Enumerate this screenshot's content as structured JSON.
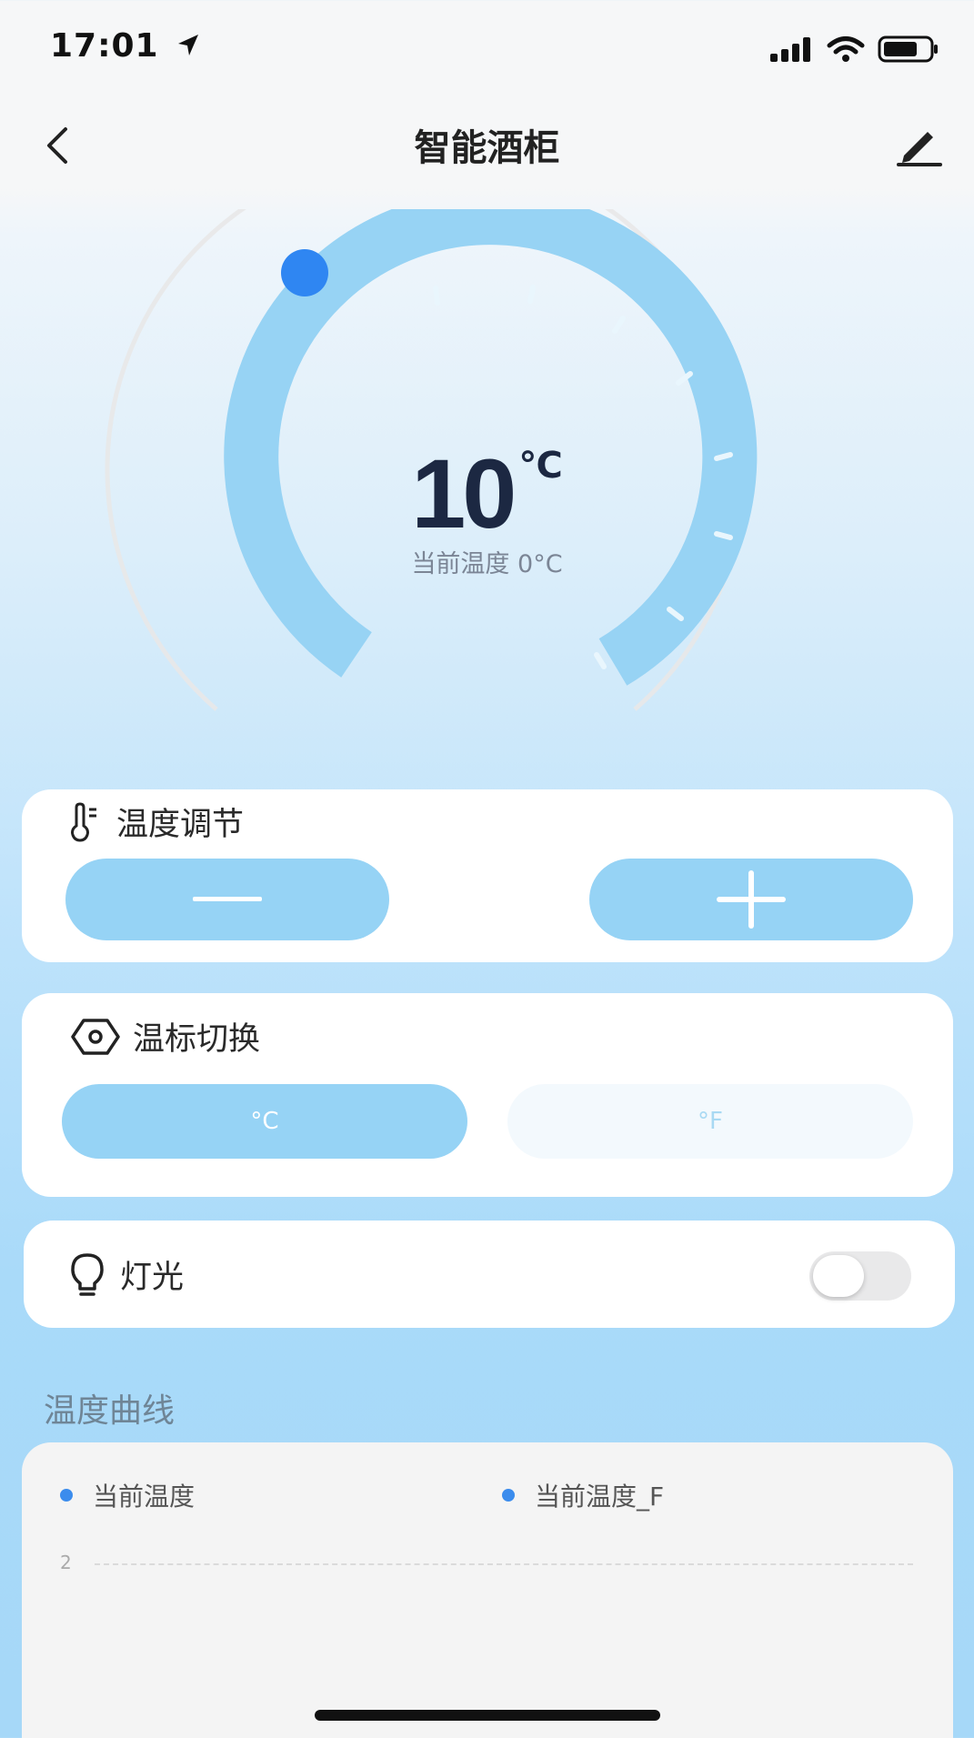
{
  "status_bar": {
    "time": "17:01"
  },
  "nav": {
    "title": "智能酒柜"
  },
  "dial": {
    "set_temp": "10",
    "unit": "℃",
    "current_label": "当前温度 0°C",
    "level": 0.0
  },
  "temp_adjust": {
    "title": "温度调节",
    "minus_icon": "minus-icon",
    "plus_icon": "plus-icon"
  },
  "unit_switch": {
    "title": "温标切换",
    "options": [
      "°C",
      "°F"
    ],
    "selected": "°C"
  },
  "light": {
    "title": "灯光",
    "on": false
  },
  "curve": {
    "section_title": "温度曲线",
    "legend": [
      "当前温度",
      "当前温度_F"
    ],
    "y_tick": "2"
  },
  "colors": {
    "accent": "#8fd0f5",
    "dot_blue": "#3b8ced",
    "text_dark": "#1c2842"
  }
}
